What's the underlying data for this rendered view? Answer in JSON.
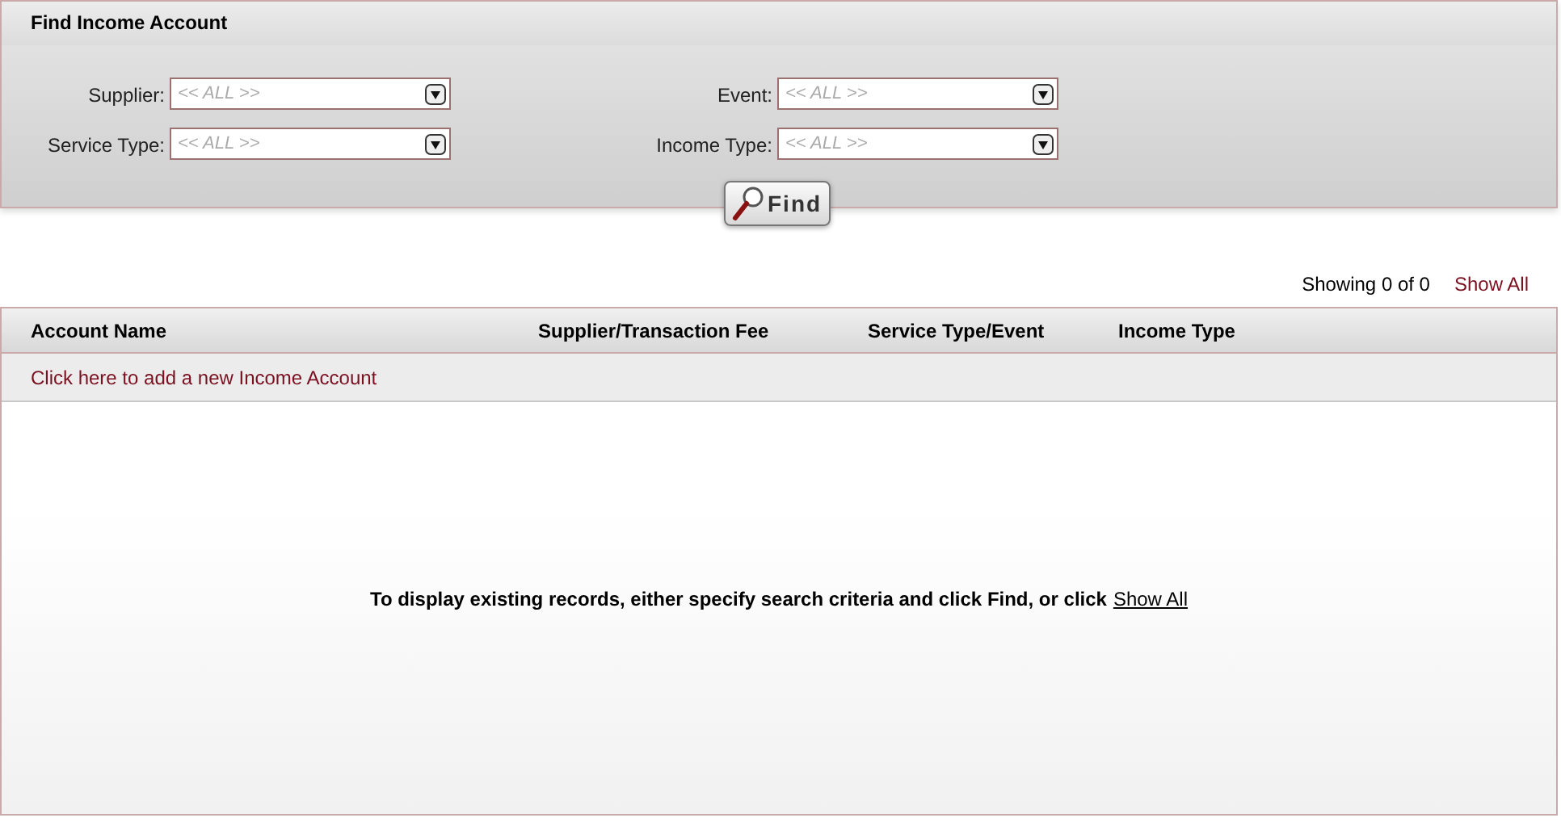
{
  "search_panel": {
    "title": "Find Income Account",
    "filters": [
      {
        "label": "Supplier:",
        "placeholder": "<< ALL >>"
      },
      {
        "label": "Event:",
        "placeholder": "<< ALL >>"
      },
      {
        "label": "Service Type:",
        "placeholder": "<< ALL >>"
      },
      {
        "label": "Income Type:",
        "placeholder": "<< ALL >>"
      }
    ],
    "find_button": "Find"
  },
  "results": {
    "count": "Showing 0 of 0",
    "show_all": "Show All",
    "columns": [
      "Account Name",
      "Supplier/Transaction Fee",
      "Service Type/Event",
      "Income Type"
    ],
    "add_link": "Click here to add a new Income Account",
    "empty_message": "To display existing records, either specify search criteria and click Find, or click",
    "empty_link": "Show All"
  }
}
